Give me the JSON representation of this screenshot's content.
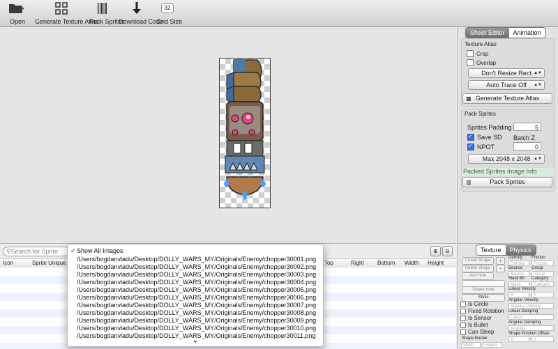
{
  "toolbar": {
    "open": "Open",
    "generate": "Generate Texture Atlas",
    "pack": "Pack Sprites",
    "download": "Download Code",
    "grid_size": "Grid Size",
    "grid_value": "32"
  },
  "right_panel": {
    "tabs": [
      "Sheet Editor",
      "Animation"
    ],
    "texture_atlas": {
      "title": "Texture Atlas",
      "crop": "Crop",
      "overlap": "Overlap",
      "resize": "Don't Resize Rect",
      "autotrace": "Auto Trace Off",
      "generate_button": "Generate Texture Atlas"
    },
    "pack_sprites": {
      "title": "Pack Sprites",
      "padding_label": "Sprites Padding",
      "padding_value": "5",
      "save_sd": "Save SD",
      "batch_z": "Batch Z",
      "batch_z_value": "0",
      "npot": "NPOT",
      "max_size": "Max 2048 x 2048",
      "packed_info": "Packed Sprites Image Info",
      "pack_button": "Pack Sprites"
    }
  },
  "bottom": {
    "search_placeholder": "Search for Sprite",
    "columns": [
      "Icon",
      "Sprite Unique N",
      "Top",
      "Right",
      "Bottom",
      "Width",
      "Height"
    ]
  },
  "menu": {
    "items": [
      "Show All Images",
      "/Users/bogdanvladu/Desktop/DOLLY_WARS_MY/Originals/Enemy/chopper30001.png",
      "/Users/bogdanvladu/Desktop/DOLLY_WARS_MY/Originals/Enemy/chopper30002.png",
      "/Users/bogdanvladu/Desktop/DOLLY_WARS_MY/Originals/Enemy/chopper30003.png",
      "/Users/bogdanvladu/Desktop/DOLLY_WARS_MY/Originals/Enemy/chopper30004.png",
      "/Users/bogdanvladu/Desktop/DOLLY_WARS_MY/Originals/Enemy/chopper30005.png",
      "/Users/bogdanvladu/Desktop/DOLLY_WARS_MY/Originals/Enemy/chopper30006.png",
      "/Users/bogdanvladu/Desktop/DOLLY_WARS_MY/Originals/Enemy/chopper30007.png",
      "/Users/bogdanvladu/Desktop/DOLLY_WARS_MY/Originals/Enemy/chopper30008.png",
      "/Users/bogdanvladu/Desktop/DOLLY_WARS_MY/Originals/Enemy/chopper30009.png",
      "/Users/bogdanvladu/Desktop/DOLLY_WARS_MY/Originals/Enemy/chopper30010.png",
      "/Users/bogdanvladu/Desktop/DOLLY_WARS_MY/Originals/Enemy/chopper30011.png"
    ]
  },
  "physics": {
    "tabs": [
      "Texture",
      "Physics"
    ],
    "create_shape": "Create Shape",
    "delete_shape": "Delete Shape",
    "add_hole": "Add Hole",
    "delete_hole": "Delete Hole",
    "body_type": "Static",
    "is_circle": "Is Circle",
    "fixed_rotation": "Fixed Rotation",
    "is_sensor": "Is Sensor",
    "is_bullet": "Is Bullet",
    "can_sleep": "Can Sleep",
    "shape_border": "Shape Border",
    "width_ph": "Width",
    "height_ph": "Height",
    "density": "Density",
    "friction": "Friction",
    "bounce": "Bounce",
    "group": "Group",
    "mask_bit": "Mask Bit",
    "category": "Category",
    "mask_ph": "Mask",
    "category_ph": "Category",
    "linear_velocity": "Linear Velocity",
    "x_ph": "X",
    "y_ph": "Y",
    "angular_velocity": "Angular Velocity",
    "angular_velocity_ph": "Angular Velocity",
    "linear_damping": "Linear Damping",
    "linear_ph": "Linear",
    "angular_damping": "Angular Damping",
    "angular_ph": "Angular",
    "shape_position_offset": "Shape Position Offset"
  }
}
